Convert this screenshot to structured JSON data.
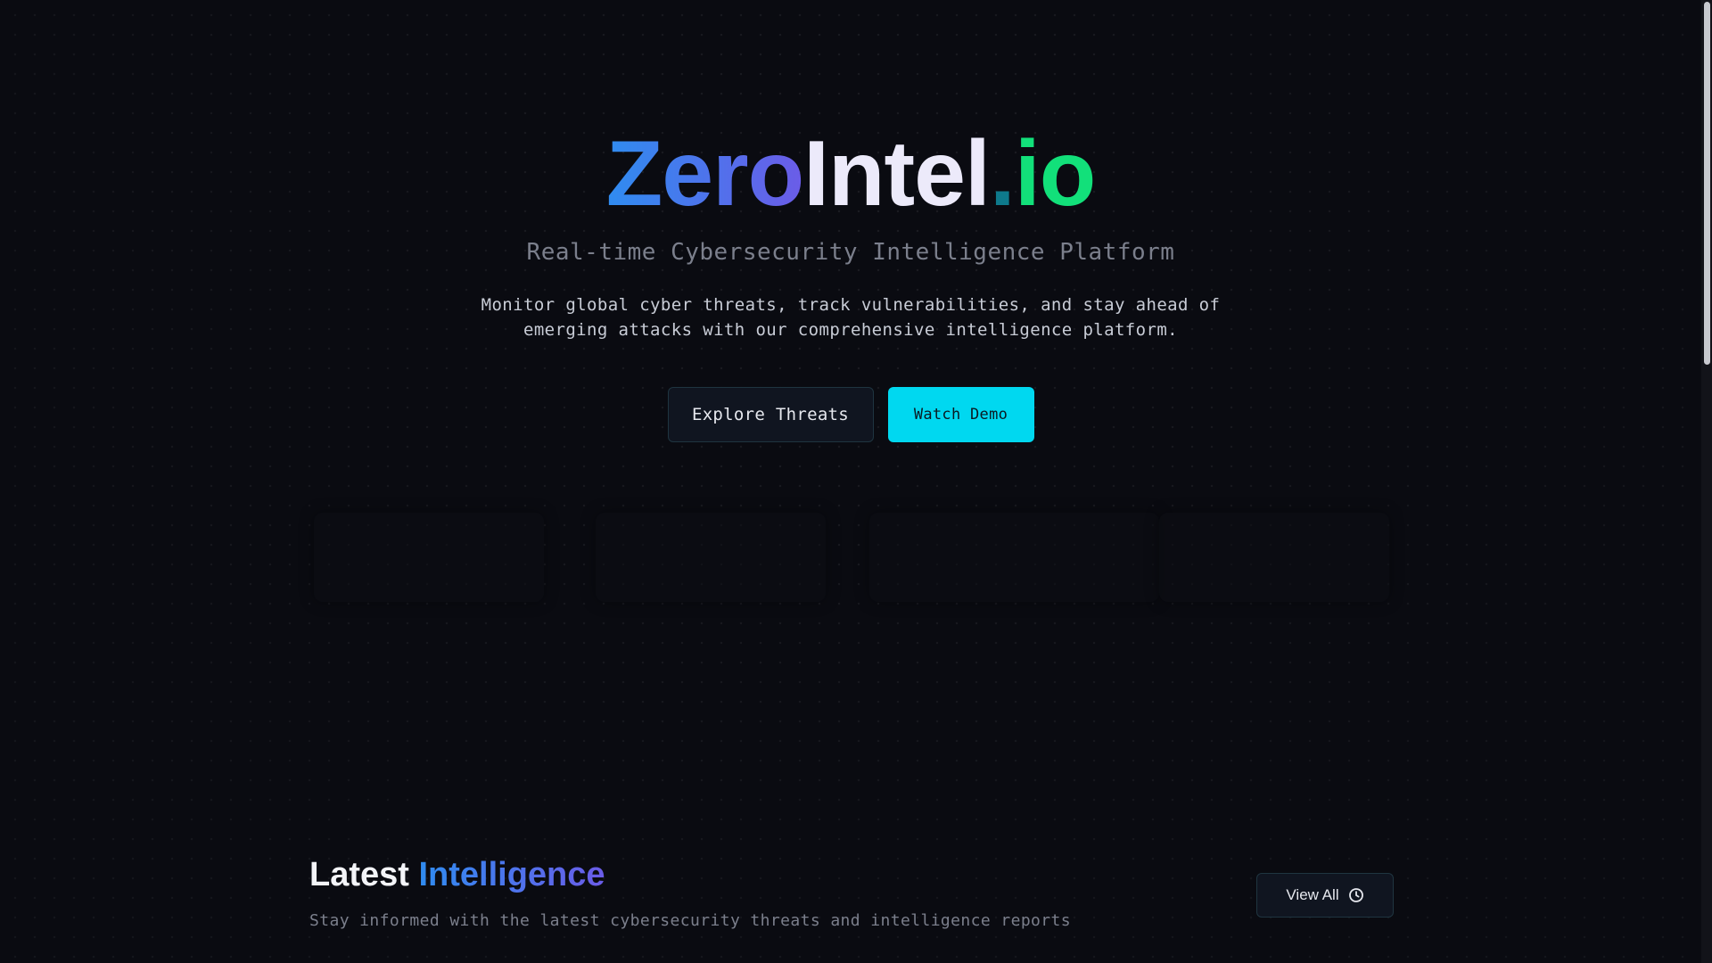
{
  "hero": {
    "brand": {
      "part1": "Zero",
      "part2": "Intel",
      "dot": ".",
      "part3": "io"
    },
    "tagline": "Real-time Cybersecurity Intelligence Platform",
    "description": "Monitor global cyber threats, track vulnerabilities, and stay ahead of emerging attacks with our comprehensive intelligence platform.",
    "buttons": {
      "explore": "Explore Threats",
      "demo": "Watch Demo"
    }
  },
  "latest": {
    "title_plain": "Latest",
    "title_accent": "Intelligence",
    "subtitle": "Stay informed with the latest cybersecurity threats and intelligence reports",
    "view_all": "View All",
    "view_all_icon": "clock-icon"
  },
  "colors": {
    "background": "#0a0b11",
    "accent_cyan": "#00d8f0",
    "accent_green": "#12e07a",
    "accent_blue": "#2f8cf0",
    "accent_violet": "#6b5ce8"
  }
}
